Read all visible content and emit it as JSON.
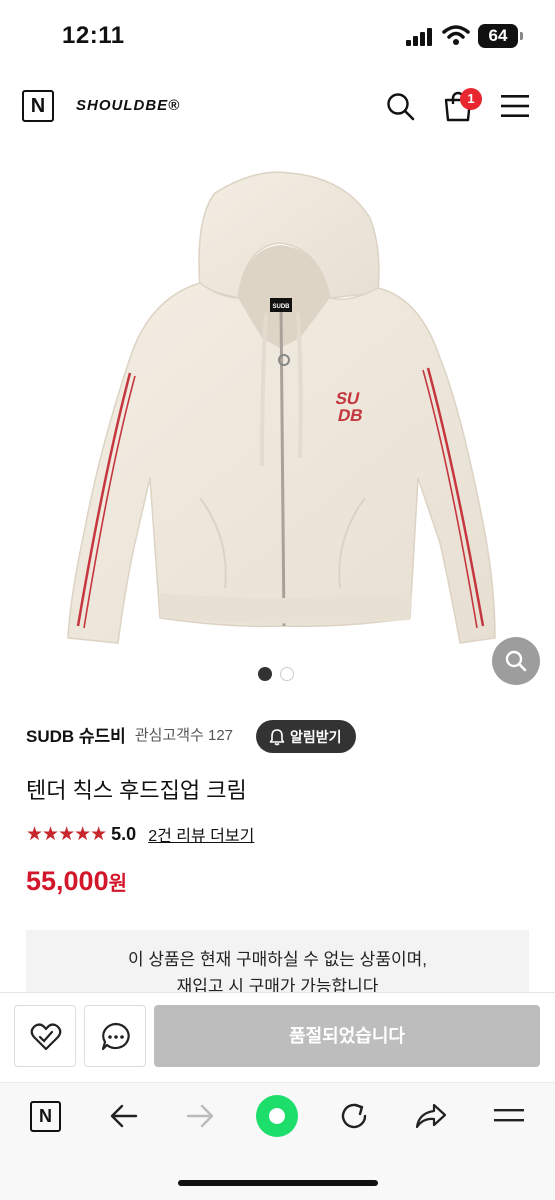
{
  "status_bar": {
    "time": "12:11",
    "battery": "64"
  },
  "header": {
    "logo_letter": "N",
    "brand": "SHOULDBE®",
    "cart_count": "1"
  },
  "product_image": {
    "gallery_index": 1,
    "gallery_total": 2,
    "chest_logo": [
      "SU",
      "DB"
    ],
    "tag_text": "SUDB"
  },
  "product": {
    "brand": "SUDB 슈드비",
    "interest": "관심고객수 127",
    "alarm_label": "알림받기",
    "title": "텐더 칙스 후드집업 크림",
    "stars": "★★★★★",
    "score": "5.0",
    "review_link": "2건 리뷰 더보기",
    "price": "55,000",
    "currency": "원"
  },
  "notice": {
    "line1": "이 상품은 현재 구매하실 수 없는 상품이며,",
    "line2": "재입고 시 구매가 가능합니다"
  },
  "action_bar": {
    "soldout_label": "품절되었습니다"
  },
  "browser_bar": {
    "logo_letter": "N"
  },
  "colors": {
    "price": "#d3172a",
    "badge": "#e8262f",
    "stars": "#c8262e",
    "green": "#1ddd6b"
  }
}
